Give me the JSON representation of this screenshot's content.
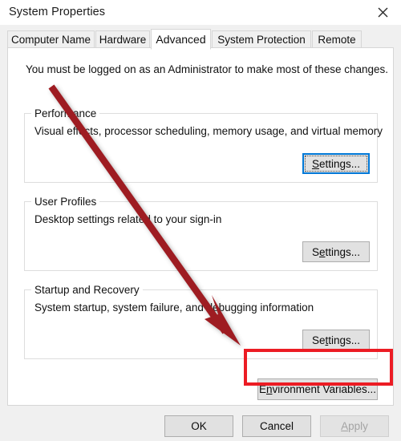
{
  "window": {
    "title": "System Properties",
    "close_icon": "close-icon"
  },
  "tabs": [
    {
      "label": "Computer Name",
      "selected": false
    },
    {
      "label": "Hardware",
      "selected": false
    },
    {
      "label": "Advanced",
      "selected": true
    },
    {
      "label": "System Protection",
      "selected": false
    },
    {
      "label": "Remote",
      "selected": false
    }
  ],
  "panel": {
    "admin_note": "You must be logged on as an Administrator to make most of these changes.",
    "groups": [
      {
        "title": "Performance",
        "description": "Visual effects, processor scheduling, memory usage, and virtual memory",
        "button": {
          "label": "Settings...",
          "accel": "S",
          "focused": true
        }
      },
      {
        "title": "User Profiles",
        "description": "Desktop settings related to your sign-in",
        "button": {
          "label": "Settings...",
          "accel": "e",
          "focused": false
        }
      },
      {
        "title": "Startup and Recovery",
        "description": "System startup, system failure, and debugging information",
        "button": {
          "label": "Settings...",
          "accel": "t",
          "focused": false
        }
      }
    ],
    "env_button": {
      "label": "Environment Variables...",
      "accel": "n",
      "highlighted": true
    }
  },
  "footer": {
    "ok": "OK",
    "cancel": "Cancel",
    "apply": "Apply",
    "apply_disabled": true
  },
  "annotations": {
    "arrow_color": "#9e1b20",
    "highlight_color": "#ec1c24",
    "focus_color": "#0078d7"
  }
}
